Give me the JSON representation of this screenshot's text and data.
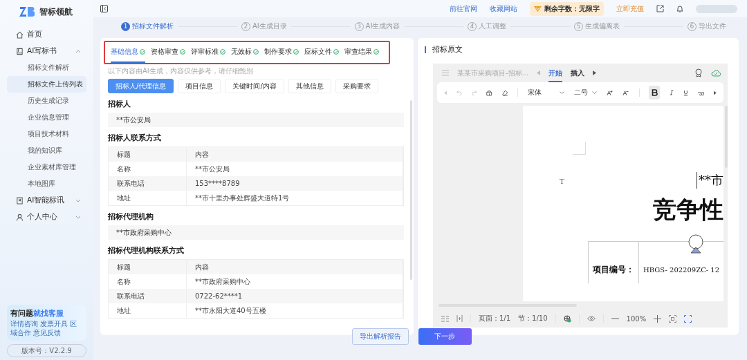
{
  "brand": {
    "name": "智标领航"
  },
  "sidebar": {
    "items": [
      {
        "label": "首页"
      },
      {
        "label": "AI写标书",
        "expanded": true,
        "children": [
          {
            "label": "招标文件解析",
            "selected": false
          },
          {
            "label": "招标文件上传列表",
            "selected": true
          },
          {
            "label": "历史生成记录",
            "selected": false
          },
          {
            "label": "企业信息管理",
            "selected": false
          },
          {
            "label": "项目技术材料",
            "selected": false
          },
          {
            "label": "我的知识库",
            "selected": false
          },
          {
            "label": "企业素材库管理",
            "selected": false
          },
          {
            "label": "本地图库",
            "selected": false
          }
        ]
      },
      {
        "label": "AI智能标讯",
        "expanded": false
      },
      {
        "label": "个人中心",
        "expanded": false
      }
    ],
    "promo": {
      "title": "有问题",
      "title_highlight": "就找客服",
      "subtitle": "详情咨询 发票开具 区域合作 意见反馈"
    },
    "version": "版本号：V2.2.9"
  },
  "header": {
    "links": [
      "前往官网",
      "收藏网站"
    ],
    "quota": "剩余字数：无限字",
    "recharge": "立即充值"
  },
  "steps": [
    {
      "number": "1",
      "label": "招标文件解析",
      "active": true
    },
    {
      "number": "2",
      "label": "AI生成目录",
      "active": false
    },
    {
      "number": "3",
      "label": "AI生成内容",
      "active": false
    },
    {
      "number": "4",
      "label": "人工调整",
      "active": false
    },
    {
      "number": "5",
      "label": "生成偏离表",
      "active": false
    },
    {
      "number": "6",
      "label": "导出文件",
      "active": false
    }
  ],
  "left_panel": {
    "tabs": [
      {
        "label": "基础信息",
        "selected": true,
        "done": true
      },
      {
        "label": "资格审查",
        "selected": false,
        "done": true
      },
      {
        "label": "评审标准",
        "selected": false,
        "done": true
      },
      {
        "label": "无效标",
        "selected": false,
        "done": true
      },
      {
        "label": "制作要求",
        "selected": false,
        "done": true
      },
      {
        "label": "应标文件",
        "selected": false,
        "done": true
      },
      {
        "label": "审查结果",
        "selected": false,
        "done": true
      }
    ],
    "hint": "以下内容由AI生成，内容仅供参考，请仔细甄别",
    "subtabs": [
      {
        "label": "招标人/代理信息",
        "selected": true
      },
      {
        "label": "项目信息",
        "selected": false
      },
      {
        "label": "关键时间/内容",
        "selected": false
      },
      {
        "label": "其他信息",
        "selected": false
      },
      {
        "label": "采购要求",
        "selected": false
      }
    ],
    "sections": [
      {
        "kind": "text",
        "title": "招标人",
        "value": "**市公安局"
      },
      {
        "kind": "table",
        "title": "招标人联系方式",
        "columns": [
          "标题",
          "内容"
        ],
        "rows": [
          [
            "名称",
            "**市公安局"
          ],
          [
            "联系电话",
            "153****8789"
          ],
          [
            "地址",
            "**市十里办事处辉盛大道特1号"
          ]
        ]
      },
      {
        "kind": "text",
        "title": "招标代理机构",
        "value": "**市政府采购中心"
      },
      {
        "kind": "table",
        "title": "招标代理机构联系方式",
        "columns": [
          "标题",
          "内容"
        ],
        "rows": [
          [
            "名称",
            "**市政府采购中心"
          ],
          [
            "联系电话",
            "0722-62****1"
          ],
          [
            "地址",
            "**市永阳大道40号五楼"
          ]
        ]
      }
    ]
  },
  "right_panel": {
    "title": "招标原文",
    "editor": {
      "doc_name": "某某市采购项目-招标...",
      "tabs": [
        {
          "label": "开始",
          "selected": true
        },
        {
          "label": "插入",
          "selected": false
        }
      ],
      "font": "宋体",
      "size": "二号",
      "bold_active": true,
      "page": {
        "marker": "T",
        "heading_fragment": "**市",
        "title_fragment": "竞争性",
        "field_label": "项目编号：",
        "field_value": "HBGS- 202209ZC- 12"
      },
      "status": {
        "page": "页面：1/1",
        "section": "节：1/10",
        "zoom": "100%"
      }
    }
  },
  "footer": {
    "export": "导出解析报告",
    "next": "下一步"
  }
}
